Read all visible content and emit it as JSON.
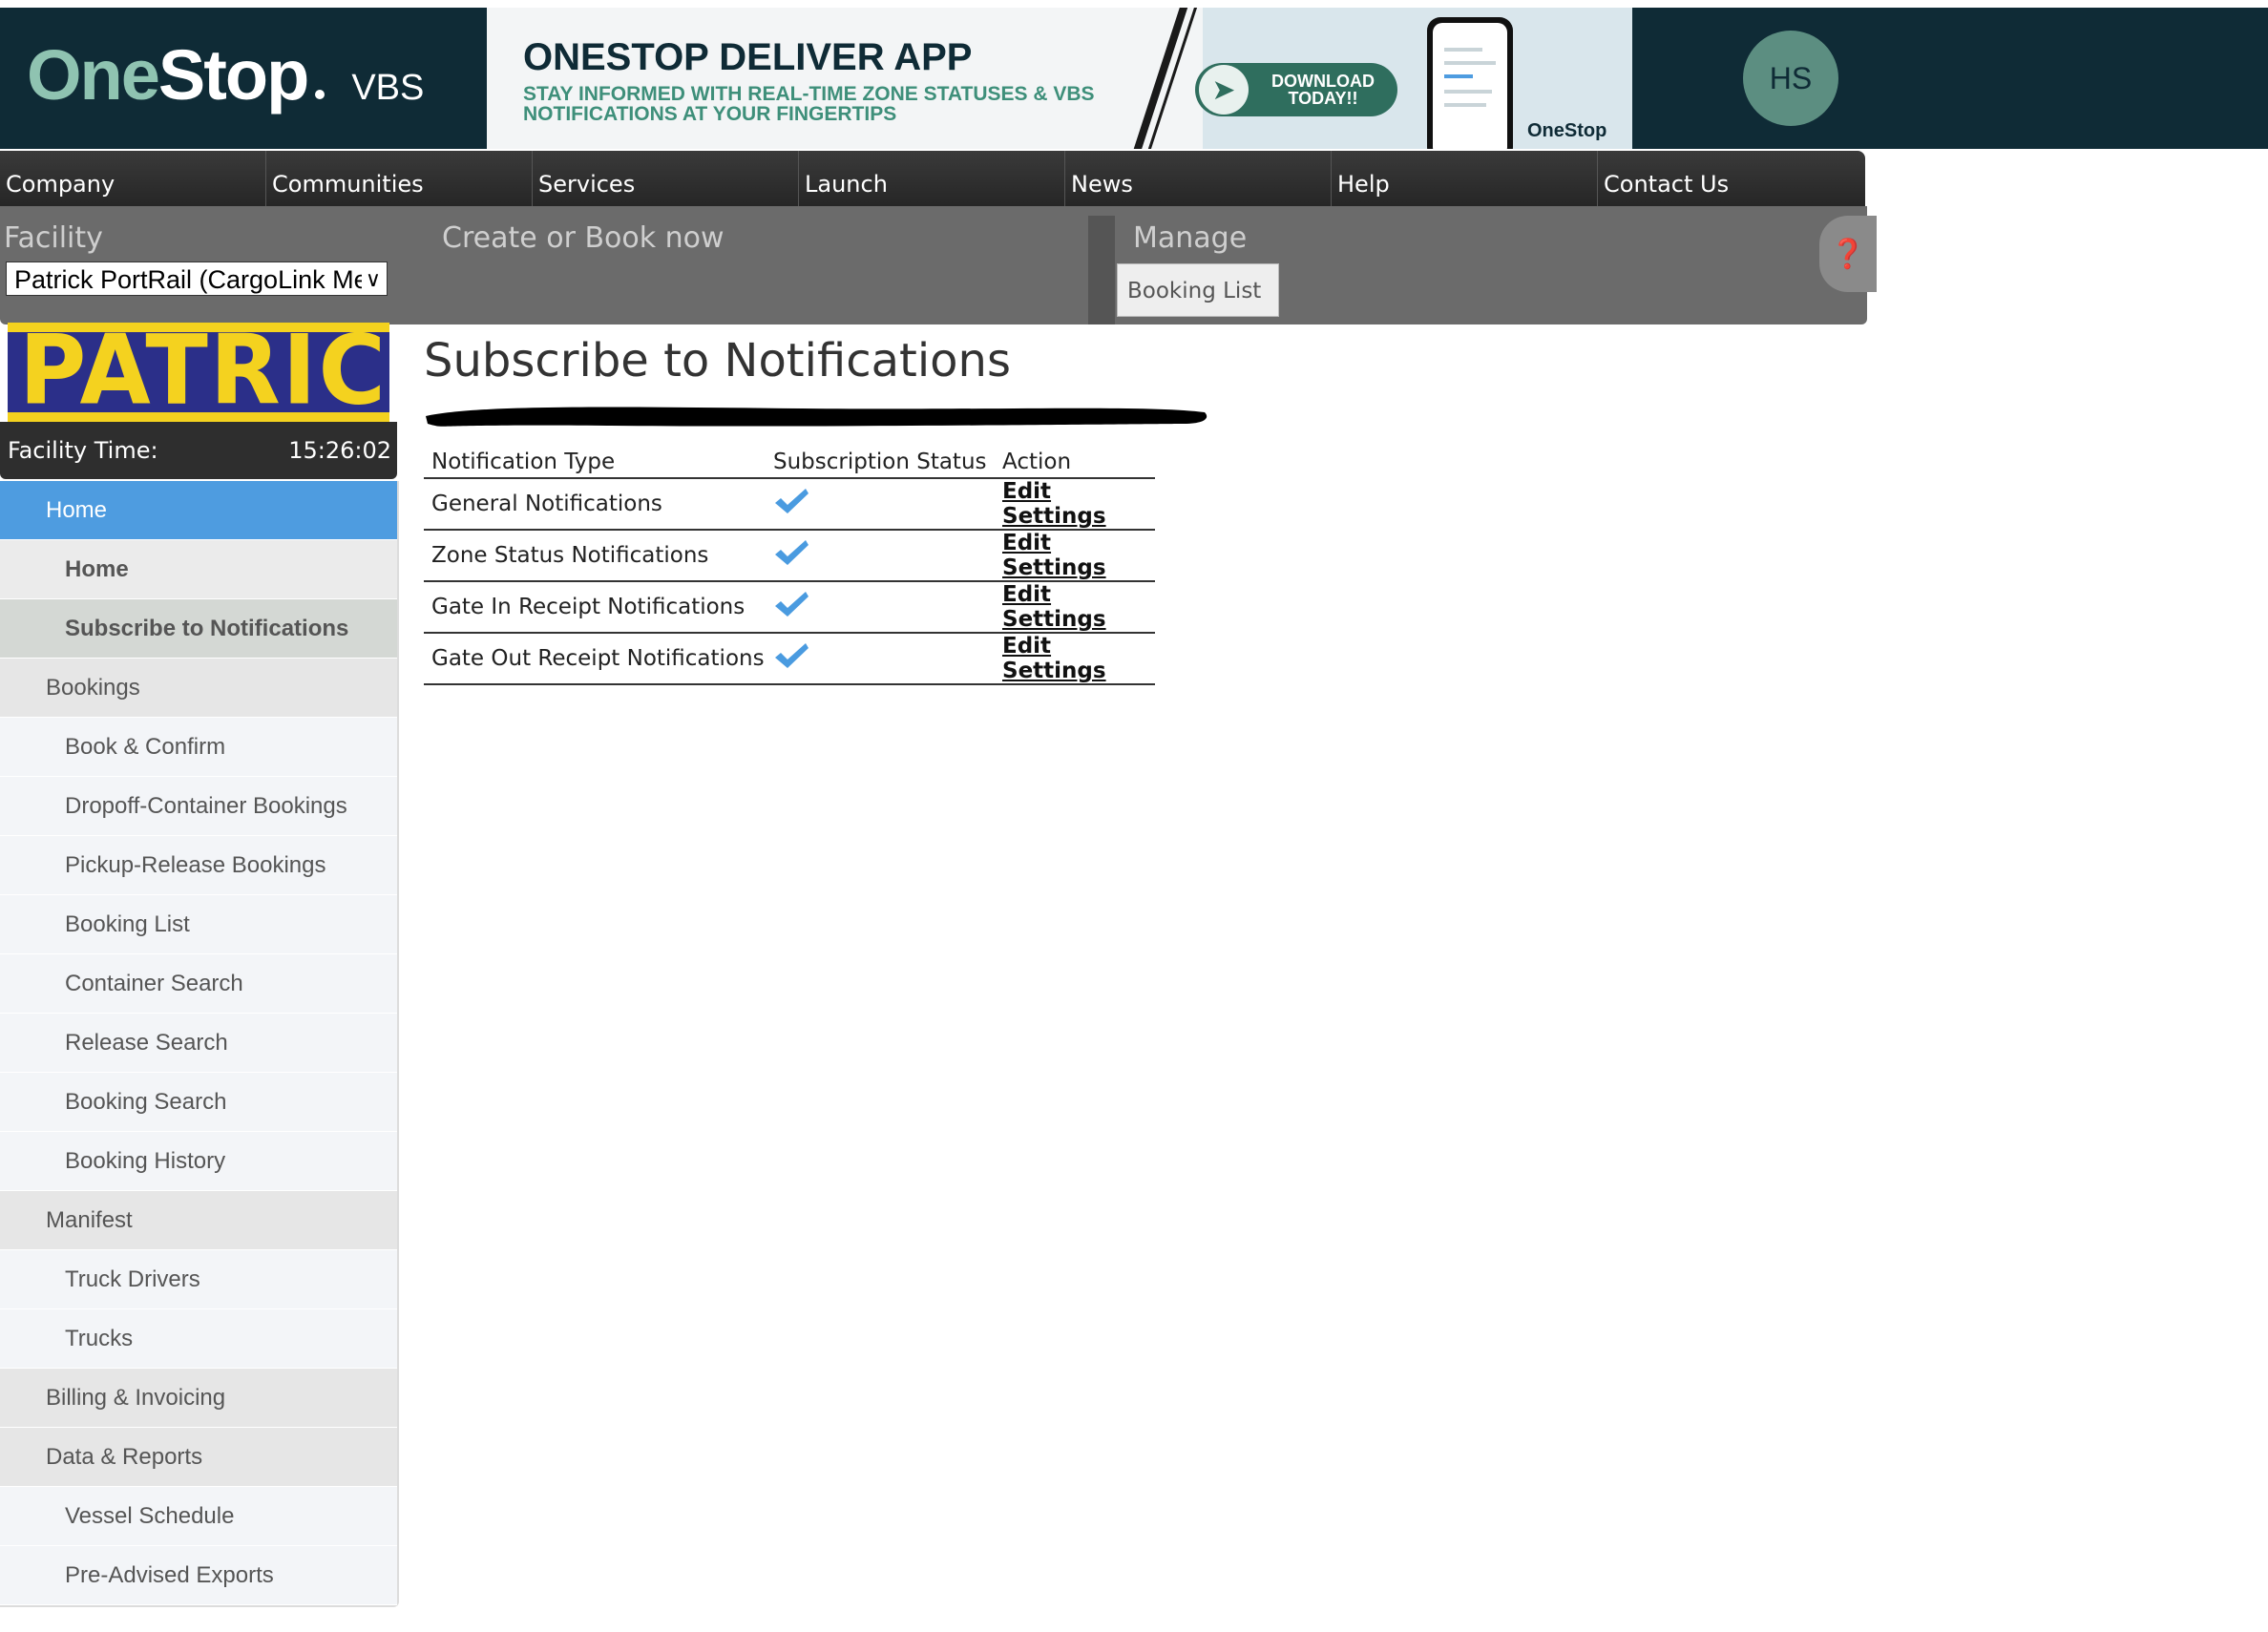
{
  "header": {
    "brand_one": "One",
    "brand_stop": "Stop",
    "brand_product": "VBS",
    "banner_title": "ONESTOP DELIVER APP",
    "banner_subtitle": "STAY INFORMED WITH REAL-TIME ZONE STATUSES & VBS NOTIFICATIONS AT YOUR FINGERTIPS",
    "banner_button_line1": "DOWNLOAD",
    "banner_button_line2": "TODAY!!",
    "banner_brand": "OneStop",
    "avatar_initials": "HS"
  },
  "topnav": {
    "items": [
      "Company",
      "Communities",
      "Services",
      "Launch",
      "News",
      "Help",
      "Contact Us"
    ]
  },
  "toolbar": {
    "facility_label": "Facility",
    "facility_selected": "Patrick PortRail (CargoLink Me",
    "create_label": "Create or Book now",
    "manage_label": "Manage",
    "booking_list_button": "Booking List"
  },
  "sidebar": {
    "facility_logo_text": "PATRICK",
    "facility_time_label": "Facility Time:",
    "facility_time_value": "15:26:02",
    "menu": [
      {
        "label": "Home",
        "type": "section",
        "state": "active"
      },
      {
        "label": "Home",
        "type": "sub",
        "state": "bold"
      },
      {
        "label": "Subscribe to Notifications",
        "type": "sub",
        "state": "current"
      },
      {
        "label": "Bookings",
        "type": "section",
        "state": ""
      },
      {
        "label": "Book & Confirm",
        "type": "sub",
        "state": ""
      },
      {
        "label": "Dropoff-Container Bookings",
        "type": "sub",
        "state": ""
      },
      {
        "label": "Pickup-Release Bookings",
        "type": "sub",
        "state": ""
      },
      {
        "label": "Booking List",
        "type": "sub",
        "state": ""
      },
      {
        "label": "Container Search",
        "type": "sub",
        "state": ""
      },
      {
        "label": "Release Search",
        "type": "sub",
        "state": ""
      },
      {
        "label": "Booking Search",
        "type": "sub",
        "state": ""
      },
      {
        "label": "Booking History",
        "type": "sub",
        "state": ""
      },
      {
        "label": "Manifest",
        "type": "section",
        "state": ""
      },
      {
        "label": "Truck Drivers",
        "type": "sub",
        "state": ""
      },
      {
        "label": "Trucks",
        "type": "sub",
        "state": ""
      },
      {
        "label": "Billing & Invoicing",
        "type": "section",
        "state": ""
      },
      {
        "label": "Data & Reports",
        "type": "section",
        "state": ""
      },
      {
        "label": "Vessel Schedule",
        "type": "sub",
        "state": ""
      },
      {
        "label": "Pre-Advised Exports",
        "type": "sub",
        "state": ""
      }
    ]
  },
  "main": {
    "title": "Subscribe to Notifications",
    "table": {
      "headers": [
        "Notification Type",
        "Subscription Status",
        "Action"
      ],
      "rows": [
        {
          "type": "General Notifications",
          "subscribed": true,
          "action": "Edit Settings"
        },
        {
          "type": "Zone Status Notifications",
          "subscribed": true,
          "action": "Edit Settings"
        },
        {
          "type": "Gate In Receipt Notifications",
          "subscribed": true,
          "action": "Edit Settings"
        },
        {
          "type": "Gate Out Receipt Notifications",
          "subscribed": true,
          "action": "Edit Settings"
        }
      ]
    }
  },
  "colors": {
    "header_bg": "#0f2b36",
    "brand_green": "#8fc3b1",
    "active_menu": "#4e9ce0",
    "check_blue": "#4a9be0",
    "toolbar_bg": "#6b6b6b"
  },
  "icons": {
    "subscribed": "checkmark-icon",
    "help": "help-icon",
    "dropdown": "chevron-down-icon"
  }
}
